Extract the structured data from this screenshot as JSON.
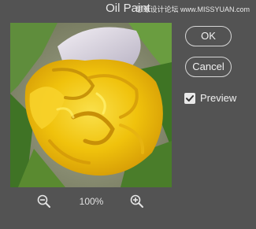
{
  "window": {
    "title": "Oil Paint",
    "watermark": "思缘设计论坛 www.MISSYUAN.com"
  },
  "buttons": {
    "ok_label": "OK",
    "cancel_label": "Cancel"
  },
  "preview_option": {
    "label": "Preview",
    "checked": true
  },
  "zoom": {
    "level": "100%",
    "zoom_out_icon": "zoom-out-magnifier-icon",
    "zoom_in_icon": "zoom-in-magnifier-icon"
  },
  "preview_image": {
    "subject": "oil painted yellow tulip",
    "colors": {
      "petal_yellow": "#f2c40f",
      "petal_white": "#d9d4dc",
      "leaf_green": "#4f8a2c",
      "background_gray": "#8f9277"
    }
  }
}
